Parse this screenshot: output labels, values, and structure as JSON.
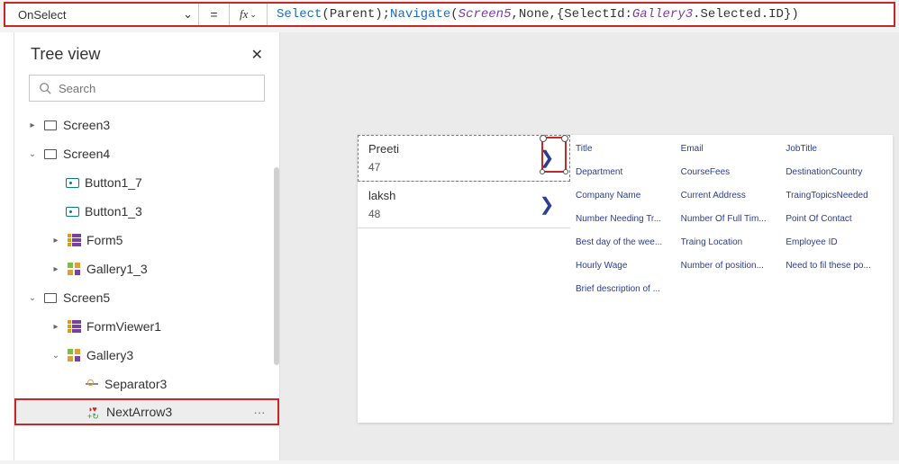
{
  "formulaBar": {
    "property": "OnSelect",
    "equals": "=",
    "fx": "fx",
    "tokens": {
      "select": "Select",
      "openParen1": "(Parent);",
      "navigate": "Navigate",
      "openParen2": "(",
      "screen5": "Screen5",
      "comma1": ",None,{SelectId:",
      "gallery3": "Gallery3",
      "tail": ".Selected.ID})"
    }
  },
  "treeView": {
    "title": "Tree view",
    "searchPlaceholder": "Search",
    "nodes": {
      "screen3": "Screen3",
      "screen4": "Screen4",
      "button1_7": "Button1_7",
      "button1_3": "Button1_3",
      "form5": "Form5",
      "gallery1_3": "Gallery1_3",
      "screen5": "Screen5",
      "formViewer1": "FormViewer1",
      "gallery3": "Gallery3",
      "separator3": "Separator3",
      "nextArrow3": "NextArrow3"
    },
    "more": "···"
  },
  "gallery": {
    "items": [
      {
        "title": "Preeti",
        "subtitle": "47"
      },
      {
        "title": "laksh",
        "subtitle": "48"
      }
    ],
    "arrowGlyph": "❯"
  },
  "fields": [
    "Title",
    "Email",
    "JobTitle",
    "Department",
    "CourseFees",
    "DestinationCountry",
    "Company Name",
    "Current Address",
    "TraingTopicsNeeded",
    "Number Needing Tr...",
    "Number Of Full Tim...",
    "Point Of Contact",
    "Best day of the wee...",
    "Traing Location",
    "Employee ID",
    "Hourly Wage",
    "Number of position...",
    "Need to fil these po...",
    "Brief description of ...",
    "",
    ""
  ]
}
